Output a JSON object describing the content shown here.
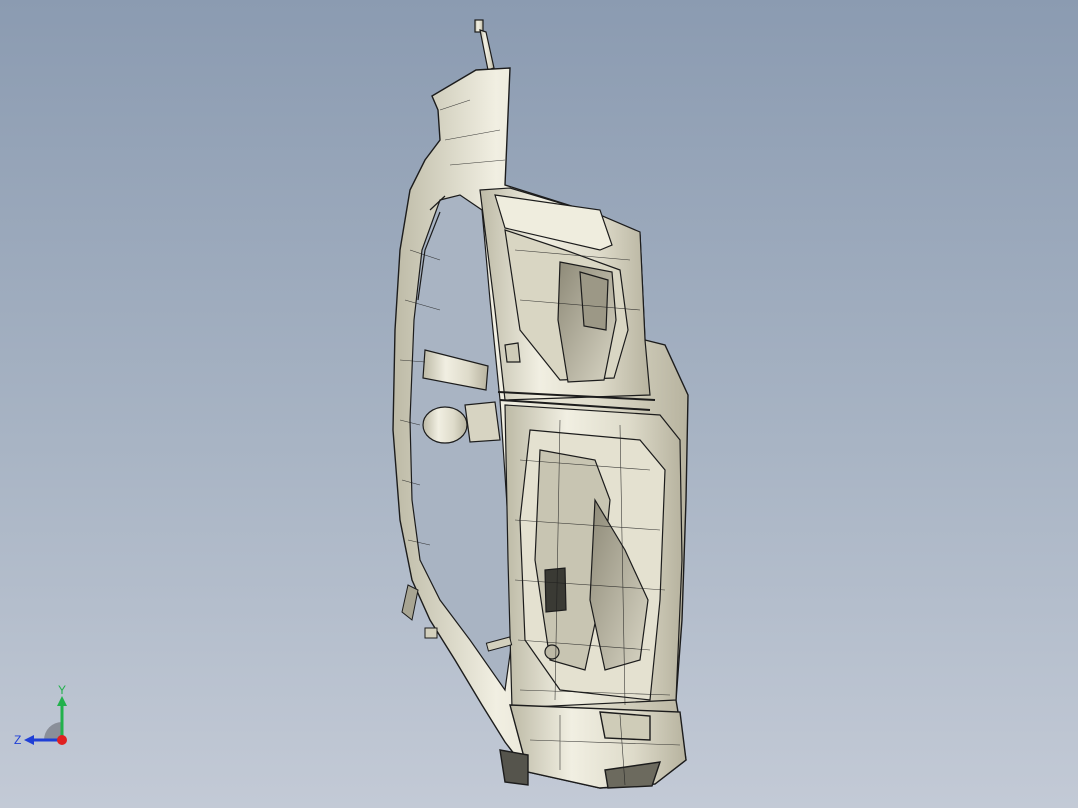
{
  "viewport": {
    "background_top": "#8b9bb1",
    "background_bottom": "#c3cad6"
  },
  "model": {
    "part_fill": "#e9e7d8",
    "part_shade": "#c9c6b3",
    "edge_color": "#1c1c1c",
    "icon": "cad-car-body-side-panel-icon"
  },
  "triad": {
    "y_label": "Y",
    "z_label": "Z",
    "y_color": "#22b14c",
    "z_color": "#1f3fd6",
    "x_color": "#e02020"
  }
}
